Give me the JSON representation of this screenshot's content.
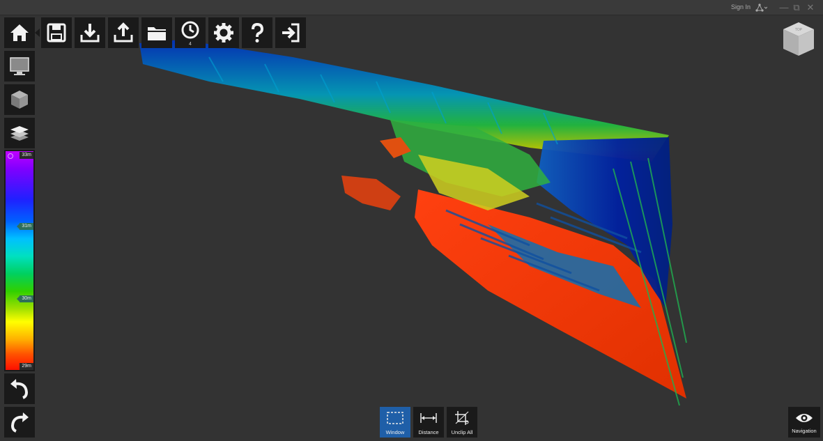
{
  "titlebar": {
    "signin_label": "Sign In",
    "account_icon": "network-icon",
    "minimize_icon": "minimize-icon",
    "restore_icon": "restore-icon",
    "close_icon": "close-icon"
  },
  "toolbar": {
    "items": [
      {
        "name": "home",
        "icon": "home-icon"
      },
      {
        "name": "save",
        "icon": "save-icon"
      },
      {
        "name": "import",
        "icon": "download-icon"
      },
      {
        "name": "export",
        "icon": "upload-icon"
      },
      {
        "name": "open",
        "icon": "folder-icon"
      },
      {
        "name": "history",
        "icon": "clock-icon",
        "count": "4"
      },
      {
        "name": "settings",
        "icon": "gear-icon"
      },
      {
        "name": "help",
        "icon": "question-icon"
      },
      {
        "name": "exit",
        "icon": "exit-icon"
      }
    ],
    "history_count": "4"
  },
  "sidebar": {
    "display_icon": "monitor-icon",
    "object_icon": "cube-icon",
    "layers_icon": "layers-icon",
    "undo_icon": "undo-icon",
    "redo_icon": "redo-icon"
  },
  "colorbar": {
    "ticks": [
      {
        "label": "33m",
        "fraction": 0.0
      },
      {
        "label": "31m",
        "fraction": 0.33
      },
      {
        "label": "30m",
        "fraction": 0.66
      },
      {
        "label": "29m",
        "fraction": 1.0
      }
    ]
  },
  "bottom_tools": {
    "window_label": "Window",
    "distance_label": "Distance",
    "unclip_label": "Unclip All",
    "active": "Window"
  },
  "navigation": {
    "label": "Navigation",
    "icon": "eye-icon"
  },
  "navcube": {
    "face_label": "TOP"
  },
  "colors": {
    "background": "#333333",
    "button_bg": "#1a1a1a",
    "active_blue": "#1f5fa8"
  }
}
